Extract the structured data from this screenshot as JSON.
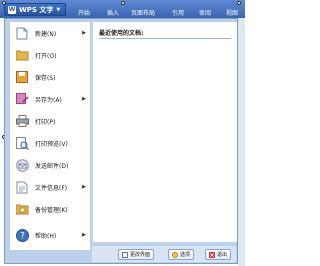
{
  "app": {
    "button_label": "WPS 文字",
    "logo_letter": "W"
  },
  "ribbon_tabs": [
    "开始",
    "插入",
    "页面布局",
    "引用",
    "审阅",
    "视图"
  ],
  "menu": {
    "items": [
      {
        "label": "新建(N)",
        "has_submenu": true,
        "icon": "new-document-icon"
      },
      {
        "label": "打开(O)",
        "has_submenu": false,
        "icon": "open-folder-icon"
      },
      {
        "label": "保存(S)",
        "has_submenu": false,
        "icon": "save-icon"
      },
      {
        "label": "另存为(A)",
        "has_submenu": true,
        "icon": "save-as-icon"
      },
      {
        "label": "打印(P)",
        "has_submenu": false,
        "icon": "print-icon"
      },
      {
        "label": "打印预览(V)",
        "has_submenu": false,
        "icon": "print-preview-icon"
      },
      {
        "label": "发送邮件(D)",
        "has_submenu": false,
        "icon": "email-icon"
      },
      {
        "label": "文件信息(F)",
        "has_submenu": true,
        "icon": "file-info-icon"
      },
      {
        "label": "备份管理(K)",
        "has_submenu": false,
        "icon": "backup-icon"
      },
      {
        "label": "帮助(H)",
        "has_submenu": true,
        "icon": "help-icon"
      }
    ]
  },
  "recent": {
    "title": "最近使用的文档:"
  },
  "footer": {
    "change_ui_label": "更改界面",
    "options_label": "选项",
    "exit_label": "退出"
  },
  "colors": {
    "ribbon": "#3a63ad",
    "menu_frame": "#bcd0ea",
    "exit_icon": "#d03a2f"
  }
}
